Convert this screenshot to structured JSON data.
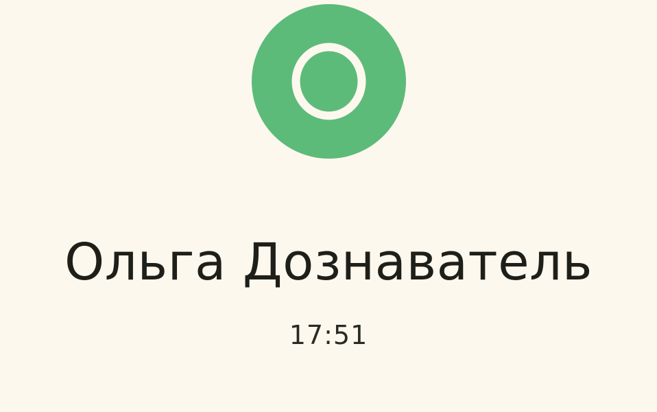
{
  "colors": {
    "background": "#fdf8ee",
    "avatar": "#5dbb79",
    "avatar_letter": "#fdf8ee",
    "text": "#1f1f1a"
  },
  "avatar": {
    "letter": "O"
  },
  "caller": {
    "name": "Ольга Дознаватель"
  },
  "call": {
    "duration": "17:51"
  }
}
